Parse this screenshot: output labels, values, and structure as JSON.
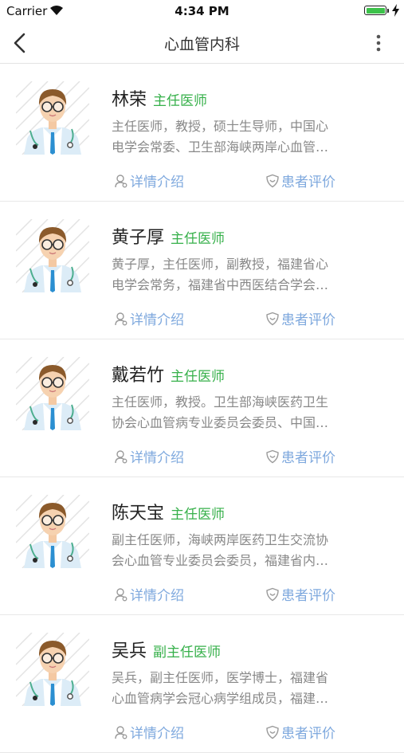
{
  "status": {
    "carrier": "Carrier",
    "time": "4:34 PM"
  },
  "nav": {
    "title": "心血管内科"
  },
  "doctors": [
    {
      "name": "林荣",
      "title": "主任医师",
      "desc1": "主任医师，教授，硕士生导师，中国心",
      "desc2": "电学会常委、卫生部海峡两岸心血管…",
      "detail": "详情介绍",
      "review": "患者评价"
    },
    {
      "name": "黄子厚",
      "title": "主任医师",
      "desc1": "黄子厚，主任医师，副教授，福建省心",
      "desc2": "电学会常务，福建省中西医结合学会…",
      "detail": "详情介绍",
      "review": "患者评价"
    },
    {
      "name": "戴若竹",
      "title": "主任医师",
      "desc1": "主任医师，教授。卫生部海峡医药卫生",
      "desc2": "协会心血管病专业委员会委员、中国…",
      "detail": "详情介绍",
      "review": "患者评价"
    },
    {
      "name": "陈天宝",
      "title": "主任医师",
      "desc1": "副主任医师，海峡两岸医药卫生交流协",
      "desc2": "会心血管专业委员会委员，福建省内…",
      "detail": "详情介绍",
      "review": "患者评价"
    },
    {
      "name": "吴兵",
      "title": "副主任医师",
      "desc1": "吴兵，副主任医师，医学博士，福建省",
      "desc2": "心血管病学会冠心病学组成员，福建…",
      "detail": "详情介绍",
      "review": "患者评价"
    }
  ]
}
